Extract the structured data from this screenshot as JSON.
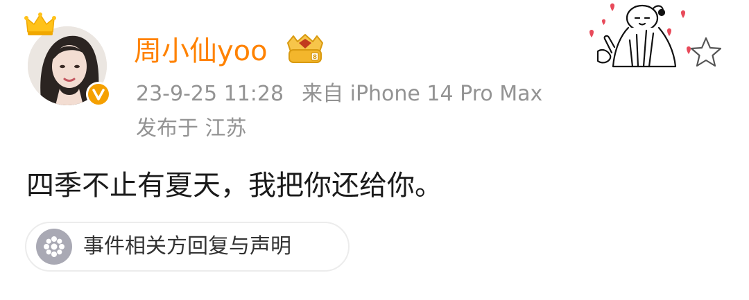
{
  "post": {
    "username": "周小仙yoo",
    "timestamp": "23-9-25 11:28",
    "source": "来自 iPhone 14 Pro Max",
    "location": "发布于 江苏",
    "text": "四季不止有夏天，我把你还给你。"
  },
  "statement_chip": {
    "label": "事件相关方回复与声明",
    "icon": "flower-icon"
  },
  "avatar": {
    "badge": "V",
    "badge_color": "#f5a000",
    "crown_icon": "crown-icon"
  },
  "colors": {
    "username": "#ff8200",
    "meta": "#939393",
    "body_text": "#1a1a1a"
  },
  "icons": {
    "member_badge": "member-badge-icon",
    "favorite": "star-icon",
    "sticker": "cartoon-sticker"
  }
}
